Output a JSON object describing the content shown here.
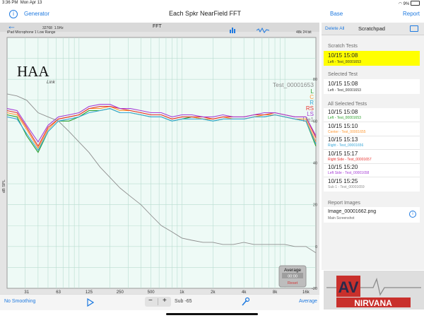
{
  "status": {
    "time": "3:36 PM",
    "date": "Mon Apr 13",
    "battery": "9%"
  },
  "nav": {
    "left": "Generator",
    "title": "Each Spkr NearField FFT",
    "base": "Base",
    "report": "Report"
  },
  "fft": {
    "title": "FFT",
    "samples": "32768",
    "res": "1.5Hz",
    "mic": "iPad Microphone 1 Low Range",
    "rate": "48k 24 bit",
    "test_label": "Test_00001653",
    "logo_main": "HAA",
    "logo_sub": "Link",
    "ylabel": "dB SPL",
    "legend": [
      {
        "label": "L",
        "color": "#2ca02c"
      },
      {
        "label": "C",
        "color": "#ff9933"
      },
      {
        "label": "R",
        "color": "#39a7d8"
      },
      {
        "label": "RS",
        "color": "#e8332f"
      },
      {
        "label": "LS",
        "color": "#a63dd6"
      },
      {
        "label": "Lfe1",
        "color": "#8e8e8e"
      }
    ],
    "y_ticks": [
      "80",
      "60",
      "40",
      "20",
      "0",
      "-20"
    ],
    "x_ticks": [
      "31",
      "63",
      "125",
      "250",
      "500",
      "1k",
      "2k",
      "4k",
      "8k",
      "16k"
    ]
  },
  "average_box": {
    "title": "Average",
    "time": "00:00",
    "reset": "Reset"
  },
  "chart_data": {
    "type": "line",
    "title": "FFT",
    "xlabel": "",
    "ylabel": "dB SPL",
    "x_scale": "log",
    "xlim": [
      20,
      20000
    ],
    "ylim": [
      -20,
      100
    ],
    "grid": true,
    "legend_position": "top-right",
    "series": [
      {
        "name": "L",
        "color": "#2ca02c",
        "x": [
          20,
          25,
          31,
          40,
          50,
          63,
          80,
          100,
          125,
          160,
          200,
          250,
          315,
          400,
          500,
          630,
          800,
          1000,
          1250,
          1600,
          2000,
          2500,
          3150,
          4000,
          5000,
          6300,
          8000,
          10000,
          12500,
          16000,
          20000
        ],
        "y": [
          63,
          62,
          53,
          45,
          55,
          60,
          60,
          62,
          65,
          65,
          66,
          64,
          64,
          63,
          62,
          62,
          60,
          61,
          62,
          61,
          60,
          61,
          61,
          61,
          62,
          62,
          63,
          62,
          61,
          60,
          48
        ]
      },
      {
        "name": "C",
        "color": "#ff9933",
        "x": [
          20,
          25,
          31,
          40,
          50,
          63,
          80,
          100,
          125,
          160,
          200,
          250,
          315,
          400,
          500,
          630,
          800,
          1000,
          1250,
          1600,
          2000,
          2500,
          3150,
          4000,
          5000,
          6300,
          8000,
          10000,
          12500,
          16000,
          20000
        ],
        "y": [
          64,
          63,
          56,
          47,
          56,
          61,
          62,
          63,
          66,
          66,
          67,
          65,
          65,
          64,
          63,
          63,
          61,
          62,
          62,
          61,
          61,
          62,
          61,
          61,
          62,
          63,
          63,
          62,
          61,
          61,
          50
        ]
      },
      {
        "name": "R",
        "color": "#39a7d8",
        "x": [
          20,
          25,
          31,
          40,
          50,
          63,
          80,
          100,
          125,
          160,
          200,
          250,
          315,
          400,
          500,
          630,
          800,
          1000,
          1250,
          1600,
          2000,
          2500,
          3150,
          4000,
          5000,
          6300,
          8000,
          10000,
          12500,
          16000,
          20000
        ],
        "y": [
          62,
          61,
          54,
          46,
          55,
          60,
          61,
          62,
          64,
          65,
          66,
          64,
          64,
          63,
          62,
          62,
          60,
          61,
          61,
          61,
          60,
          61,
          61,
          61,
          62,
          62,
          63,
          62,
          61,
          60,
          49
        ]
      },
      {
        "name": "RS",
        "color": "#e8332f",
        "x": [
          20,
          25,
          31,
          40,
          50,
          63,
          80,
          100,
          125,
          160,
          200,
          250,
          315,
          400,
          500,
          630,
          800,
          1000,
          1250,
          1600,
          2000,
          2500,
          3150,
          4000,
          5000,
          6300,
          8000,
          10000,
          12500,
          16000,
          20000
        ],
        "y": [
          65,
          64,
          57,
          48,
          57,
          61,
          62,
          63,
          66,
          67,
          67,
          66,
          65,
          64,
          63,
          63,
          61,
          62,
          62,
          62,
          61,
          62,
          62,
          62,
          63,
          63,
          64,
          63,
          62,
          62,
          52
        ]
      },
      {
        "name": "LS",
        "color": "#a63dd6",
        "x": [
          20,
          25,
          31,
          40,
          50,
          63,
          80,
          100,
          125,
          160,
          200,
          250,
          315,
          400,
          500,
          630,
          800,
          1000,
          1250,
          1600,
          2000,
          2500,
          3150,
          4000,
          5000,
          6300,
          8000,
          10000,
          12500,
          16000,
          20000
        ],
        "y": [
          66,
          65,
          58,
          50,
          58,
          62,
          63,
          64,
          67,
          68,
          68,
          66,
          66,
          65,
          64,
          64,
          62,
          63,
          63,
          62,
          62,
          63,
          62,
          62,
          63,
          64,
          64,
          63,
          62,
          62,
          53
        ]
      },
      {
        "name": "Lfe1",
        "color": "#8e8e8e",
        "x": [
          20,
          25,
          31,
          40,
          50,
          63,
          80,
          100,
          125,
          160,
          200,
          250,
          315,
          400,
          500,
          630,
          800,
          1000,
          1250,
          1600,
          2000,
          2500,
          3150,
          4000,
          5000,
          6300,
          8000,
          10000,
          12500,
          16000,
          20000
        ],
        "y": [
          73,
          72,
          70,
          64,
          62,
          60,
          55,
          50,
          45,
          38,
          33,
          28,
          24,
          20,
          15,
          10,
          7,
          4,
          3,
          2,
          2,
          1,
          1,
          2,
          1,
          1,
          1,
          1,
          0,
          0,
          -3
        ]
      }
    ]
  },
  "right": {
    "delete_all": "Delete All",
    "header_title": "Scratchpad",
    "scratch_title": "Scratch Tests",
    "scratch_item": {
      "ts": "10/15 15:08",
      "sub": "Left - Test_00001653"
    },
    "selected_title": "Selected Test",
    "selected_item": {
      "ts": "10/15 15:08",
      "sub": "Left - Test_00001653"
    },
    "all_title": "All Selected Tests",
    "all_items": [
      {
        "ts": "10/15 15:08",
        "sub": "Left - Test_00001653",
        "color": "#2ca02c"
      },
      {
        "ts": "10/15 15:10",
        "sub": "Center - Test_00001655",
        "color": "#ff9933"
      },
      {
        "ts": "10/15 15:13",
        "sub": "Right - Test_00001656",
        "color": "#39a7d8"
      },
      {
        "ts": "10/15 15:17",
        "sub": "Right Side - Test_00001657",
        "color": "#e8332f"
      },
      {
        "ts": "10/15 15:20",
        "sub": "Left Side - Test_00001658",
        "color": "#a63dd6"
      },
      {
        "ts": "10/15 15:25",
        "sub": "Sub 1 - Test_00001659",
        "color": "#8e8e8e"
      }
    ],
    "report_images_title": "Report Images",
    "report_image": {
      "name": "Image_00001662.png",
      "sub": "Main Screenshot"
    }
  },
  "logo_badge": {
    "top": "AV",
    "bottom": "NIRVANA"
  },
  "toolbar": {
    "smoothing": "No Smoothing",
    "minus": "−",
    "plus": "+",
    "sub_value": "Sub -65",
    "average": "Average"
  }
}
